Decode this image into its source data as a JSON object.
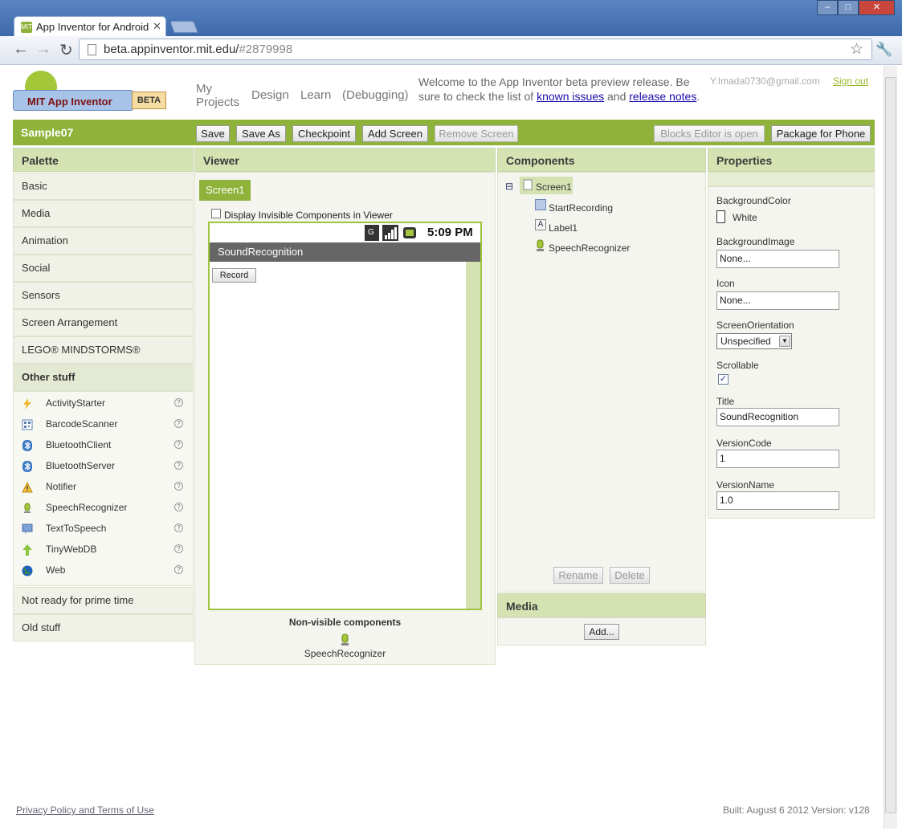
{
  "browser": {
    "tab_title": "App Inventor for Android",
    "url_host": "beta.appinventor.mit.edu/",
    "url_hash": "#2879998",
    "win_minimize": "–",
    "win_maximize": "□",
    "win_close": "✕"
  },
  "header": {
    "logo_text": "MIT App Inventor",
    "logo_badge": "BETA",
    "nav": {
      "my_projects_1": "My",
      "my_projects_2": "Projects",
      "design": "Design",
      "learn": "Learn",
      "debugging": "(Debugging)"
    },
    "welcome_1": "Welcome to the App Inventor beta preview release. Be sure to check the list of",
    "link_known_issues": "known issues",
    "welcome_and": "and",
    "link_release_notes": "release notes",
    "welcome_end": ".",
    "email": "Y.Imada0730@gmail.com",
    "sign_out": "Sign out"
  },
  "toolbar": {
    "project_name": "Sample07",
    "save": "Save",
    "save_as": "Save As",
    "checkpoint": "Checkpoint",
    "add_screen": "Add Screen",
    "remove_screen": "Remove Screen",
    "blocks_editor": "Blocks Editor is open",
    "package": "Package for Phone"
  },
  "palette": {
    "title": "Palette",
    "categories": [
      "Basic",
      "Media",
      "Animation",
      "Social",
      "Sensors",
      "Screen Arrangement",
      "LEGO® MINDSTORMS®",
      "Other stuff"
    ],
    "other_items": [
      "ActivityStarter",
      "BarcodeScanner",
      "BluetoothClient",
      "BluetoothServer",
      "Notifier",
      "SpeechRecognizer",
      "TextToSpeech",
      "TinyWebDB",
      "Web"
    ],
    "bottom_categories": [
      "Not ready for prime time",
      "Old stuff"
    ],
    "help_glyph": "?"
  },
  "viewer": {
    "title": "Viewer",
    "screen_tab": "Screen1",
    "display_invisible": "Display Invisible Components in Viewer",
    "time": "5:09 PM",
    "app_title": "SoundRecognition",
    "record_button": "Record",
    "nonvisible_title": "Non-visible components",
    "nonvisible_item": "SpeechRecognizer"
  },
  "components": {
    "title": "Components",
    "collapse_glyph": "⊟",
    "root": "Screen1",
    "children": [
      "StartRecording",
      "Label1",
      "SpeechRecognizer"
    ],
    "label_icon_glyph": "A",
    "rename": "Rename",
    "delete": "Delete",
    "media_title": "Media",
    "add": "Add..."
  },
  "properties": {
    "title": "Properties",
    "background_color_label": "BackgroundColor",
    "background_color_value": "White",
    "background_image_label": "BackgroundImage",
    "background_image_value": "None...",
    "icon_label": "Icon",
    "icon_value": "None...",
    "orientation_label": "ScreenOrientation",
    "orientation_value": "Unspecified",
    "scrollable_label": "Scrollable",
    "scrollable_check": "✓",
    "title_label": "Title",
    "title_value": "SoundRecognition",
    "version_code_label": "VersionCode",
    "version_code_value": "1",
    "version_name_label": "VersionName",
    "version_name_value": "1.0"
  },
  "footer": {
    "privacy": "Privacy Policy and Terms of Use",
    "built": "Built: August 6 2012 Version: v128"
  }
}
